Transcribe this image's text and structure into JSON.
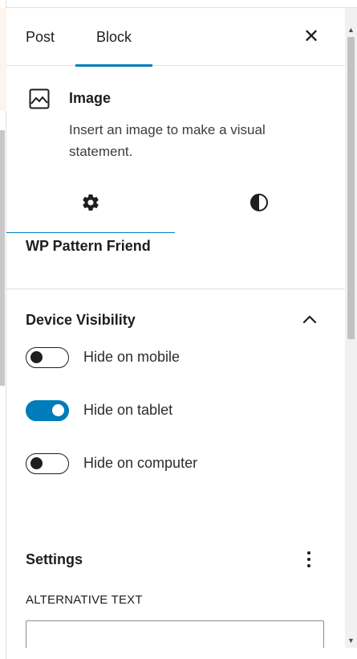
{
  "sidebar": {
    "tabs": [
      {
        "label": "Post"
      },
      {
        "label": "Block"
      }
    ],
    "close_icon": "close-icon"
  },
  "block_card": {
    "icon": "image-icon",
    "name": "Image",
    "description": "Insert an image to make a visual statement."
  },
  "inspector_tabs": [
    {
      "icon": "gear-icon",
      "name": "Settings",
      "active": true
    },
    {
      "icon": "contrast-icon",
      "name": "Styles",
      "active": false
    }
  ],
  "plugin": {
    "title": "WP Pattern Friend"
  },
  "device_visibility": {
    "title": "Device Visibility",
    "toggles": [
      {
        "label": "Hide on mobile",
        "checked": false
      },
      {
        "label": "Hide on tablet",
        "checked": true
      },
      {
        "label": "Hide on computer",
        "checked": false
      }
    ]
  },
  "settings": {
    "title": "Settings",
    "alt_text_label": "ALTERNATIVE TEXT",
    "alt_text_value": ""
  },
  "colors": {
    "accent": "#007cba",
    "text": "#1e1e1e",
    "border": "#e0e0e0"
  }
}
